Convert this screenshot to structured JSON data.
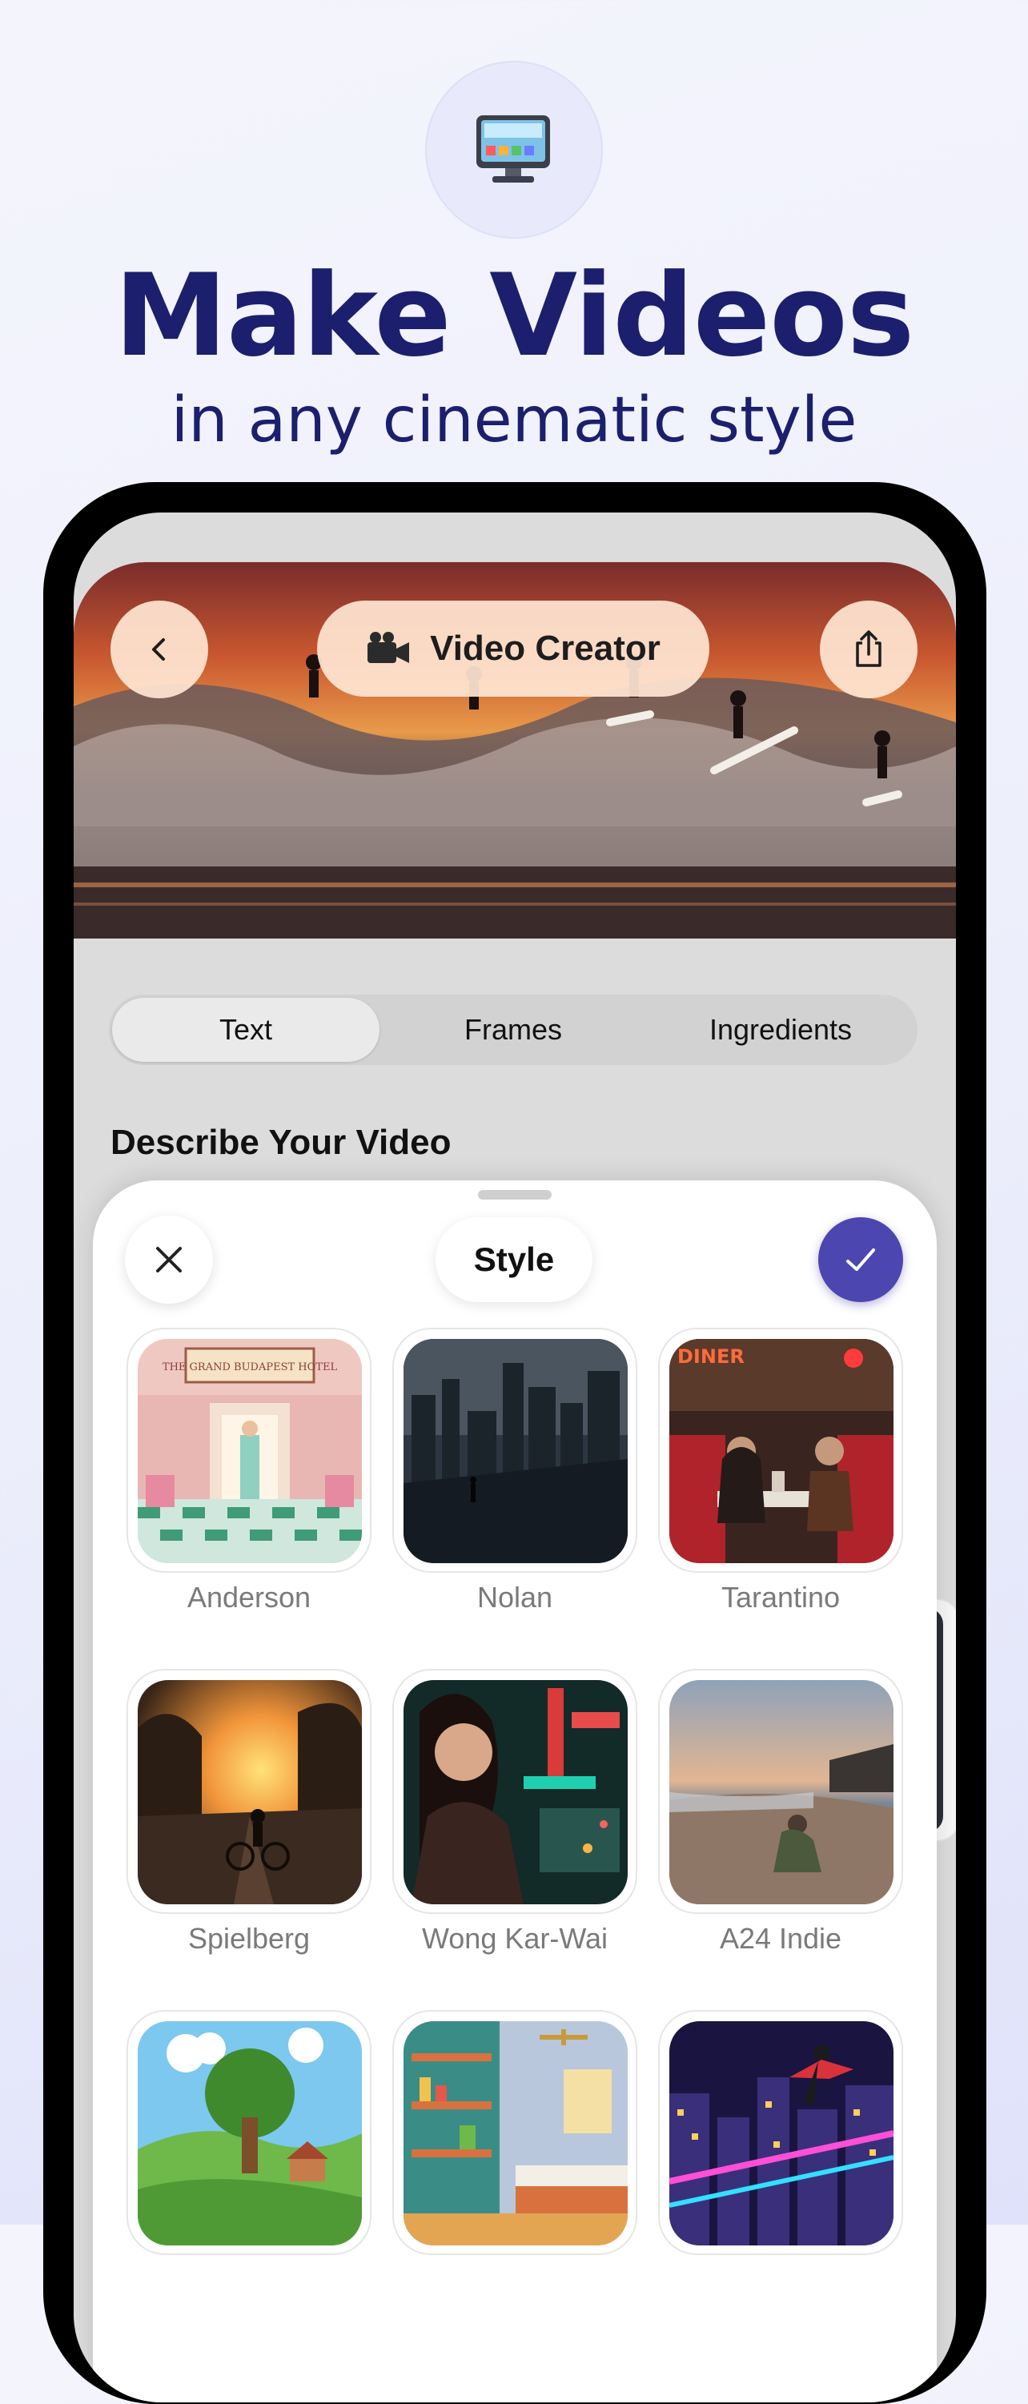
{
  "hero": {
    "icon": "tv-icon",
    "title": "Make Videos",
    "subtitle": "in any cinematic style"
  },
  "app": {
    "title": "Video Creator",
    "title_icon": "video-camera-icon",
    "back_icon": "chevron-left-icon",
    "share_icon": "share-icon",
    "tabs": [
      {
        "label": "Text",
        "active": true
      },
      {
        "label": "Frames",
        "active": false
      },
      {
        "label": "Ingredients",
        "active": false
      }
    ],
    "section_title": "Describe Your Video"
  },
  "style_sheet": {
    "title": "Style",
    "close_icon": "close-icon",
    "confirm_icon": "checkmark-icon",
    "accent_color": "#4c46b0",
    "styles": [
      {
        "label": "Anderson"
      },
      {
        "label": "Nolan"
      },
      {
        "label": "Tarantino"
      },
      {
        "label": "Spielberg"
      },
      {
        "label": "Wong Kar-Wai"
      },
      {
        "label": "A24 Indie"
      },
      {
        "label": ""
      },
      {
        "label": ""
      },
      {
        "label": ""
      }
    ],
    "thumbnail_texts": {
      "anderson": "THE GRAND BUDAPEST HOTEL",
      "tarantino": "DINER"
    }
  },
  "colors": {
    "headline": "#1c1f6d",
    "background": "#eceefb"
  }
}
